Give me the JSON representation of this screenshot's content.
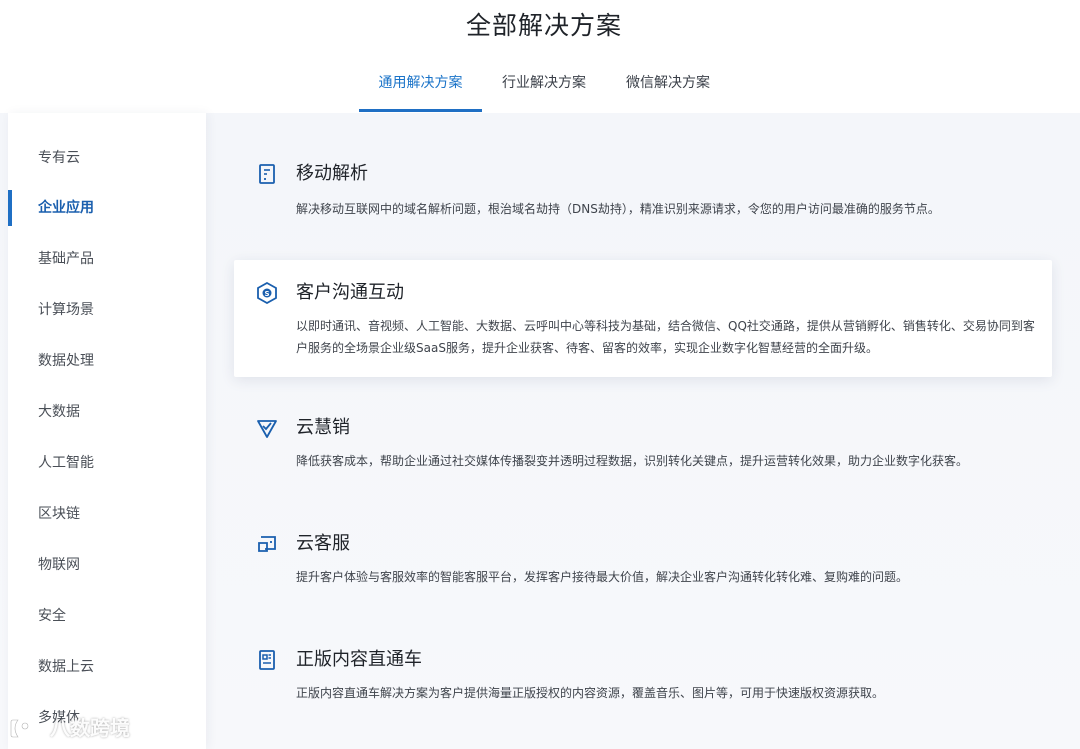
{
  "page": {
    "title": "全部解决方案"
  },
  "tabs": [
    {
      "label": "通用解决方案",
      "active": true
    },
    {
      "label": "行业解决方案",
      "active": false
    },
    {
      "label": "微信解决方案",
      "active": false
    }
  ],
  "sidebar": {
    "items": [
      {
        "label": "专有云",
        "active": false
      },
      {
        "label": "企业应用",
        "active": true
      },
      {
        "label": "基础产品",
        "active": false
      },
      {
        "label": "计算场景",
        "active": false
      },
      {
        "label": "数据处理",
        "active": false
      },
      {
        "label": "大数据",
        "active": false
      },
      {
        "label": "人工智能",
        "active": false
      },
      {
        "label": "区块链",
        "active": false
      },
      {
        "label": "物联网",
        "active": false
      },
      {
        "label": "安全",
        "active": false
      },
      {
        "label": "数据上云",
        "active": false
      },
      {
        "label": "多媒体",
        "active": false
      }
    ]
  },
  "solutions": [
    {
      "title": "移动解析",
      "icon": "mobile-doc-icon",
      "desc": "解决移动互联网中的域名解析问题，根治域名劫持（DNS劫持），精准识别来源请求，令您的用户访问最准确的服务节点。"
    },
    {
      "title": "客户沟通互动",
      "icon": "hexagon-s-icon",
      "desc": "以即时通讯、音视频、人工智能、大数据、云呼叫中心等科技为基础，结合微信、QQ社交通路，提供从营销孵化、销售转化、交易协同到客户服务的全场景企业级SaaS服务，提升企业获客、待客、留客的效率，实现企业数字化智慧经营的全面升级。"
    },
    {
      "title": "云慧销",
      "icon": "triangle-check-icon",
      "desc": "降低获客成本，帮助企业通过社交媒体传播裂变并透明过程数据，识别转化关键点，提升运营转化效果，助力企业数字化获客。"
    },
    {
      "title": "云客服",
      "icon": "chat-bubble-icon",
      "desc": "提升客户体验与客服效率的智能客服平台，发挥客户接待最大价值，解决企业客户沟通转化转化难、复购难的问题。"
    },
    {
      "title": "正版内容直通车",
      "icon": "copyright-doc-icon",
      "desc": "正版内容直通车解决方案为客户提供海量正版授权的内容资源，覆盖音乐、图片等，可用于快速版权资源获取。"
    }
  ],
  "watermark": {
    "text": "八数跨境"
  },
  "colors": {
    "accent": "#1f6fc4",
    "icon": "#1a5fae"
  }
}
